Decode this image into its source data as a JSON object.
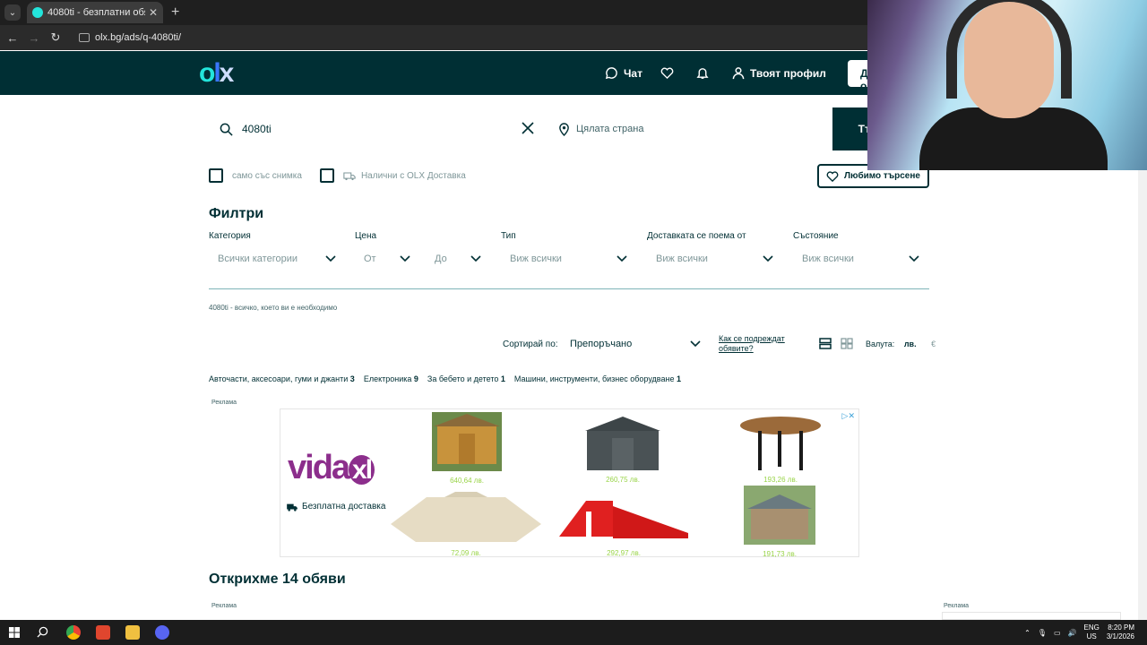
{
  "browser": {
    "tab_title": "4080ti - безплатни обяви | OLX",
    "url": "olx.bg/ads/q-4080ti/"
  },
  "header": {
    "chat": "Чат",
    "profile": "Твоят профил",
    "add_button": "Добави обява"
  },
  "search": {
    "query": "4080ti",
    "location_placeholder": "Цялата страна",
    "search_button": "Търсене"
  },
  "checkboxes": {
    "photo_only": "само със снимка",
    "olx_delivery": "Налични с OLX Доставка"
  },
  "favourite_search": "Любимо търсене",
  "filters": {
    "title": "Филтри",
    "category_label": "Категория",
    "category_value": "Всички категории",
    "price_label": "Цена",
    "price_from": "От",
    "price_to": "До",
    "type_label": "Тип",
    "type_value": "Виж всички",
    "delivery_label": "Доставката се поема от",
    "delivery_value": "Виж всички",
    "condition_label": "Състояние",
    "condition_value": "Виж всички"
  },
  "breadcrumb": "4080ti - всичко, което ви е необходимо",
  "sort": {
    "label": "Сортирай по:",
    "value": "Препоръчано",
    "how_link": "Как се подреждат обявите?",
    "currency_label": "Валута:",
    "currency_bgn": "лв.",
    "currency_eur": "€"
  },
  "categories": [
    {
      "name": "Авточасти, аксесоари, гуми и джанти",
      "count": "3"
    },
    {
      "name": "Електроника",
      "count": "9"
    },
    {
      "name": "За бебето и детето",
      "count": "1"
    },
    {
      "name": "Машини, инструменти, бизнес оборудване",
      "count": "1"
    }
  ],
  "ad": {
    "label": "Реклама",
    "brand": "vida",
    "brand_xl": "xl",
    "free_delivery": "Безплатна доставка",
    "prices": [
      "640,64 лв.",
      "260,75 лв.",
      "193,26 лв.",
      "72,09 лв.",
      "292,97 лв.",
      "191,73 лв."
    ]
  },
  "results_title": "Открихме 14 обяви",
  "ad_label2": "Реклама",
  "ad_label3": "Реклама",
  "taskbar": {
    "lang": "ENG",
    "region": "US",
    "time": "8:20 PM",
    "date": "3/1/2026"
  }
}
